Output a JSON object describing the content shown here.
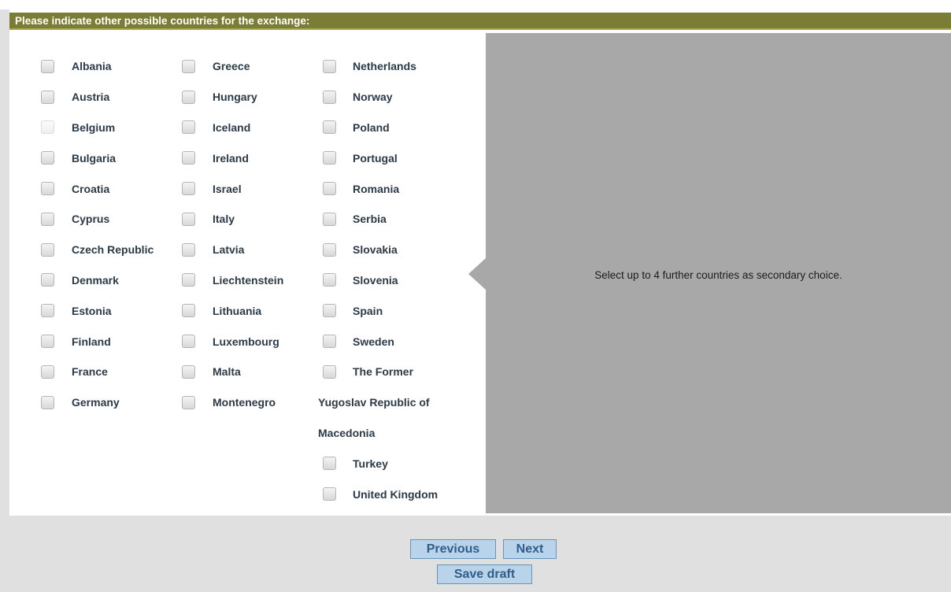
{
  "header": {
    "title": "Please indicate other possible countries for the exchange:"
  },
  "help": {
    "text": "Select up to 4 further countries as secondary choice."
  },
  "columns": {
    "c1": [
      "Albania",
      "Austria",
      "Belgium",
      "Bulgaria",
      "Croatia",
      "Cyprus",
      "Czech Republic",
      "Denmark",
      "Estonia",
      "Finland",
      "France",
      "Germany"
    ],
    "c2": [
      "Greece",
      "Hungary",
      "Iceland",
      "Ireland",
      "Israel",
      "Italy",
      "Latvia",
      "Liechtenstein",
      "Lithuania",
      "Luxembourg",
      "Malta",
      "Montenegro"
    ],
    "c3": [
      "Netherlands",
      "Norway",
      "Poland",
      "Portugal",
      "Romania",
      "Serbia",
      "Slovakia",
      "Slovenia",
      "Spain",
      "Sweden",
      "The Former"
    ],
    "c3_wrap": [
      "Yugoslav Republic of",
      "Macedonia"
    ],
    "c3_tail": [
      "Turkey",
      "United Kingdom"
    ]
  },
  "buttons": {
    "previous": "Previous",
    "next": "Next",
    "save_draft": "Save draft"
  }
}
